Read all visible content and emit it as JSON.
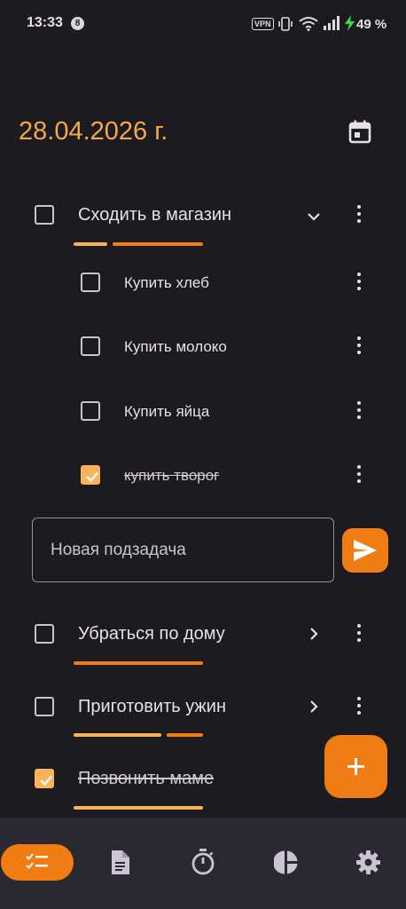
{
  "status_bar": {
    "time": "13:33",
    "notification_count": "8",
    "vpn_label": "VPN",
    "battery": "49 %"
  },
  "header": {
    "date": "28.04.2026 г."
  },
  "tasks": [
    {
      "title": "Сходить в магазин",
      "checked": false,
      "expanded": true,
      "subtasks": [
        {
          "title": "Купить хлеб",
          "checked": false
        },
        {
          "title": "Купить молоко",
          "checked": false
        },
        {
          "title": "Купить яйца",
          "checked": false
        },
        {
          "title": "купить творог",
          "checked": true
        }
      ]
    },
    {
      "title": "Убраться по дому",
      "checked": false,
      "expanded": false
    },
    {
      "title": "Приготовить ужин",
      "checked": false,
      "expanded": false
    },
    {
      "title": "Позвонить маме",
      "checked": true
    }
  ],
  "new_subtask": {
    "placeholder": "Новая подзадача",
    "value": ""
  },
  "bottom_nav": [
    "tasks-icon",
    "notes-icon",
    "timer-icon",
    "stats-icon",
    "settings-icon"
  ],
  "colors": {
    "background": "#1c1b1f",
    "accent": "#f07d13",
    "accent_light": "#fbb259",
    "date_color": "#f7a64a"
  }
}
